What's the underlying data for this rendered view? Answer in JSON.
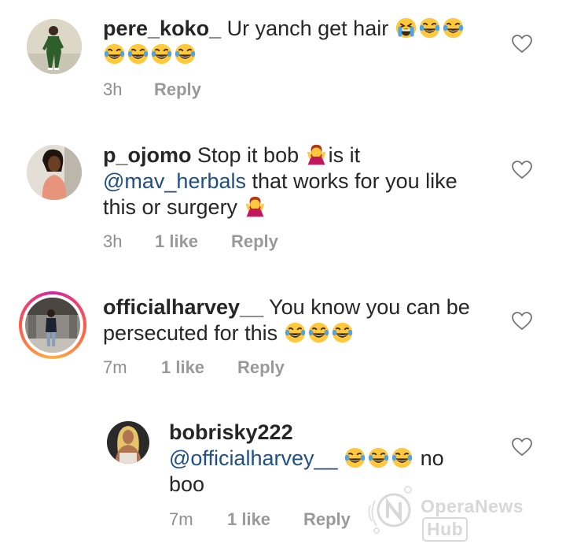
{
  "comments": [
    {
      "username": "pere_koko_",
      "text": "Ur yanch get hair",
      "time": "3h",
      "likes": "",
      "reply": "Reply",
      "avatar": "person-in-green-tracksuit"
    },
    {
      "username": "p_ojomo",
      "text_before": "Stop it bob",
      "text_mid": "is it",
      "mention": "@mav_herbals",
      "text_after": "that works for you like",
      "text_line3": "this or surgery",
      "time": "3h",
      "likes": "1 like",
      "reply": "Reply",
      "avatar": "woman-in-orange-top"
    },
    {
      "username": "officialharvey__",
      "text_line1": "You know you can be",
      "text_line2": "persecuted for this",
      "time": "7m",
      "likes": "1 like",
      "reply": "Reply",
      "avatar": "man-in-mall-with-story-ring"
    },
    {
      "username": "bobrisky222",
      "mention": "@officialharvey__",
      "text_after": "no",
      "text_line2": "boo",
      "time": "7m",
      "likes": "1 like",
      "reply": "Reply",
      "avatar": "blonde-woman-selfie"
    }
  ],
  "watermark": {
    "brand": "OperaNews",
    "hub": "Hub"
  },
  "icons": {
    "like": "heart-outline-icon",
    "emoji_laugh": "tears-of-joy-emoji",
    "emoji_cry": "loudly-crying-emoji",
    "emoji_shrug": "woman-shrugging-emoji"
  },
  "colors": {
    "text": "#262626",
    "meta": "#8e8e8e",
    "mention": "#1f4f86",
    "emoji_face": "#ffc83d"
  }
}
